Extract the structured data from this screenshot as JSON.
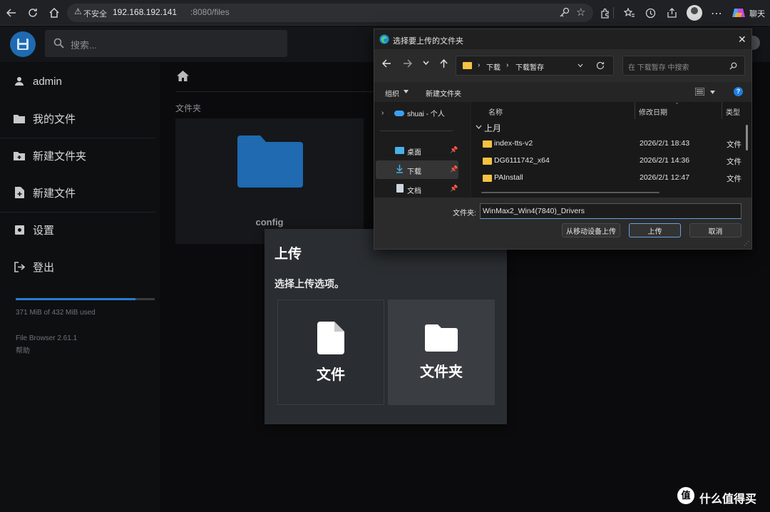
{
  "browser": {
    "insecure_label": "不安全",
    "url_host": "192.168.192.141",
    "url_path": ":8080/files",
    "chat_label": "聊天"
  },
  "filebrowser": {
    "search_placeholder": "搜索...",
    "sidebar": [
      {
        "label": "admin",
        "icon": "person-icon"
      },
      {
        "label": "我的文件",
        "icon": "folder-icon"
      },
      {
        "label": "新建文件夹",
        "icon": "new-folder-icon"
      },
      {
        "label": "新建文件",
        "icon": "new-file-icon"
      },
      {
        "label": "设置",
        "icon": "gear-icon"
      },
      {
        "label": "登出",
        "icon": "logout-icon"
      }
    ],
    "usage_text": "371 MiB of 432 MiB used",
    "usage_fraction": 0.859,
    "version": "File Browser 2.61.1",
    "help": "帮助",
    "section_label": "文件夹",
    "folders": [
      {
        "name": "config"
      }
    ]
  },
  "upload_modal": {
    "title": "上传",
    "prompt": "选择上传选项。",
    "option_file": "文件",
    "option_folder": "文件夹"
  },
  "dialog": {
    "title": "选择要上传的文件夹",
    "crumbs": [
      "下载",
      "下载暂存"
    ],
    "search_placeholder": "在 下载暂存 中搜索",
    "organize": "组织",
    "new_folder": "新建文件夹",
    "nav_tree": [
      {
        "label": "shuai - 个人"
      },
      {
        "label": "桌面"
      },
      {
        "label": "下载"
      },
      {
        "label": "文档"
      }
    ],
    "columns": {
      "name": "名称",
      "modified": "修改日期",
      "type": "类型"
    },
    "group": "上月",
    "rows": [
      {
        "name": "index-tts-v2",
        "modified": "2026/2/1 18:43",
        "type": "文件"
      },
      {
        "name": "DG6111742_x64",
        "modified": "2026/2/1 14:36",
        "type": "文件"
      },
      {
        "name": "PAInstall",
        "modified": "2026/2/1 12:47",
        "type": "文件"
      }
    ],
    "folder_label": "文件夹:",
    "folder_value": "WinMax2_Win4(7840)_Drivers",
    "btn_mobile": "从移动设备上传",
    "btn_upload": "上传",
    "btn_cancel": "取消"
  },
  "watermark": {
    "text": "什么值得买",
    "badge": "值"
  },
  "colors": {
    "accent": "#2a7bd3",
    "folder_blue": "#1f6ab0",
    "win_folder": "#f5c242"
  }
}
